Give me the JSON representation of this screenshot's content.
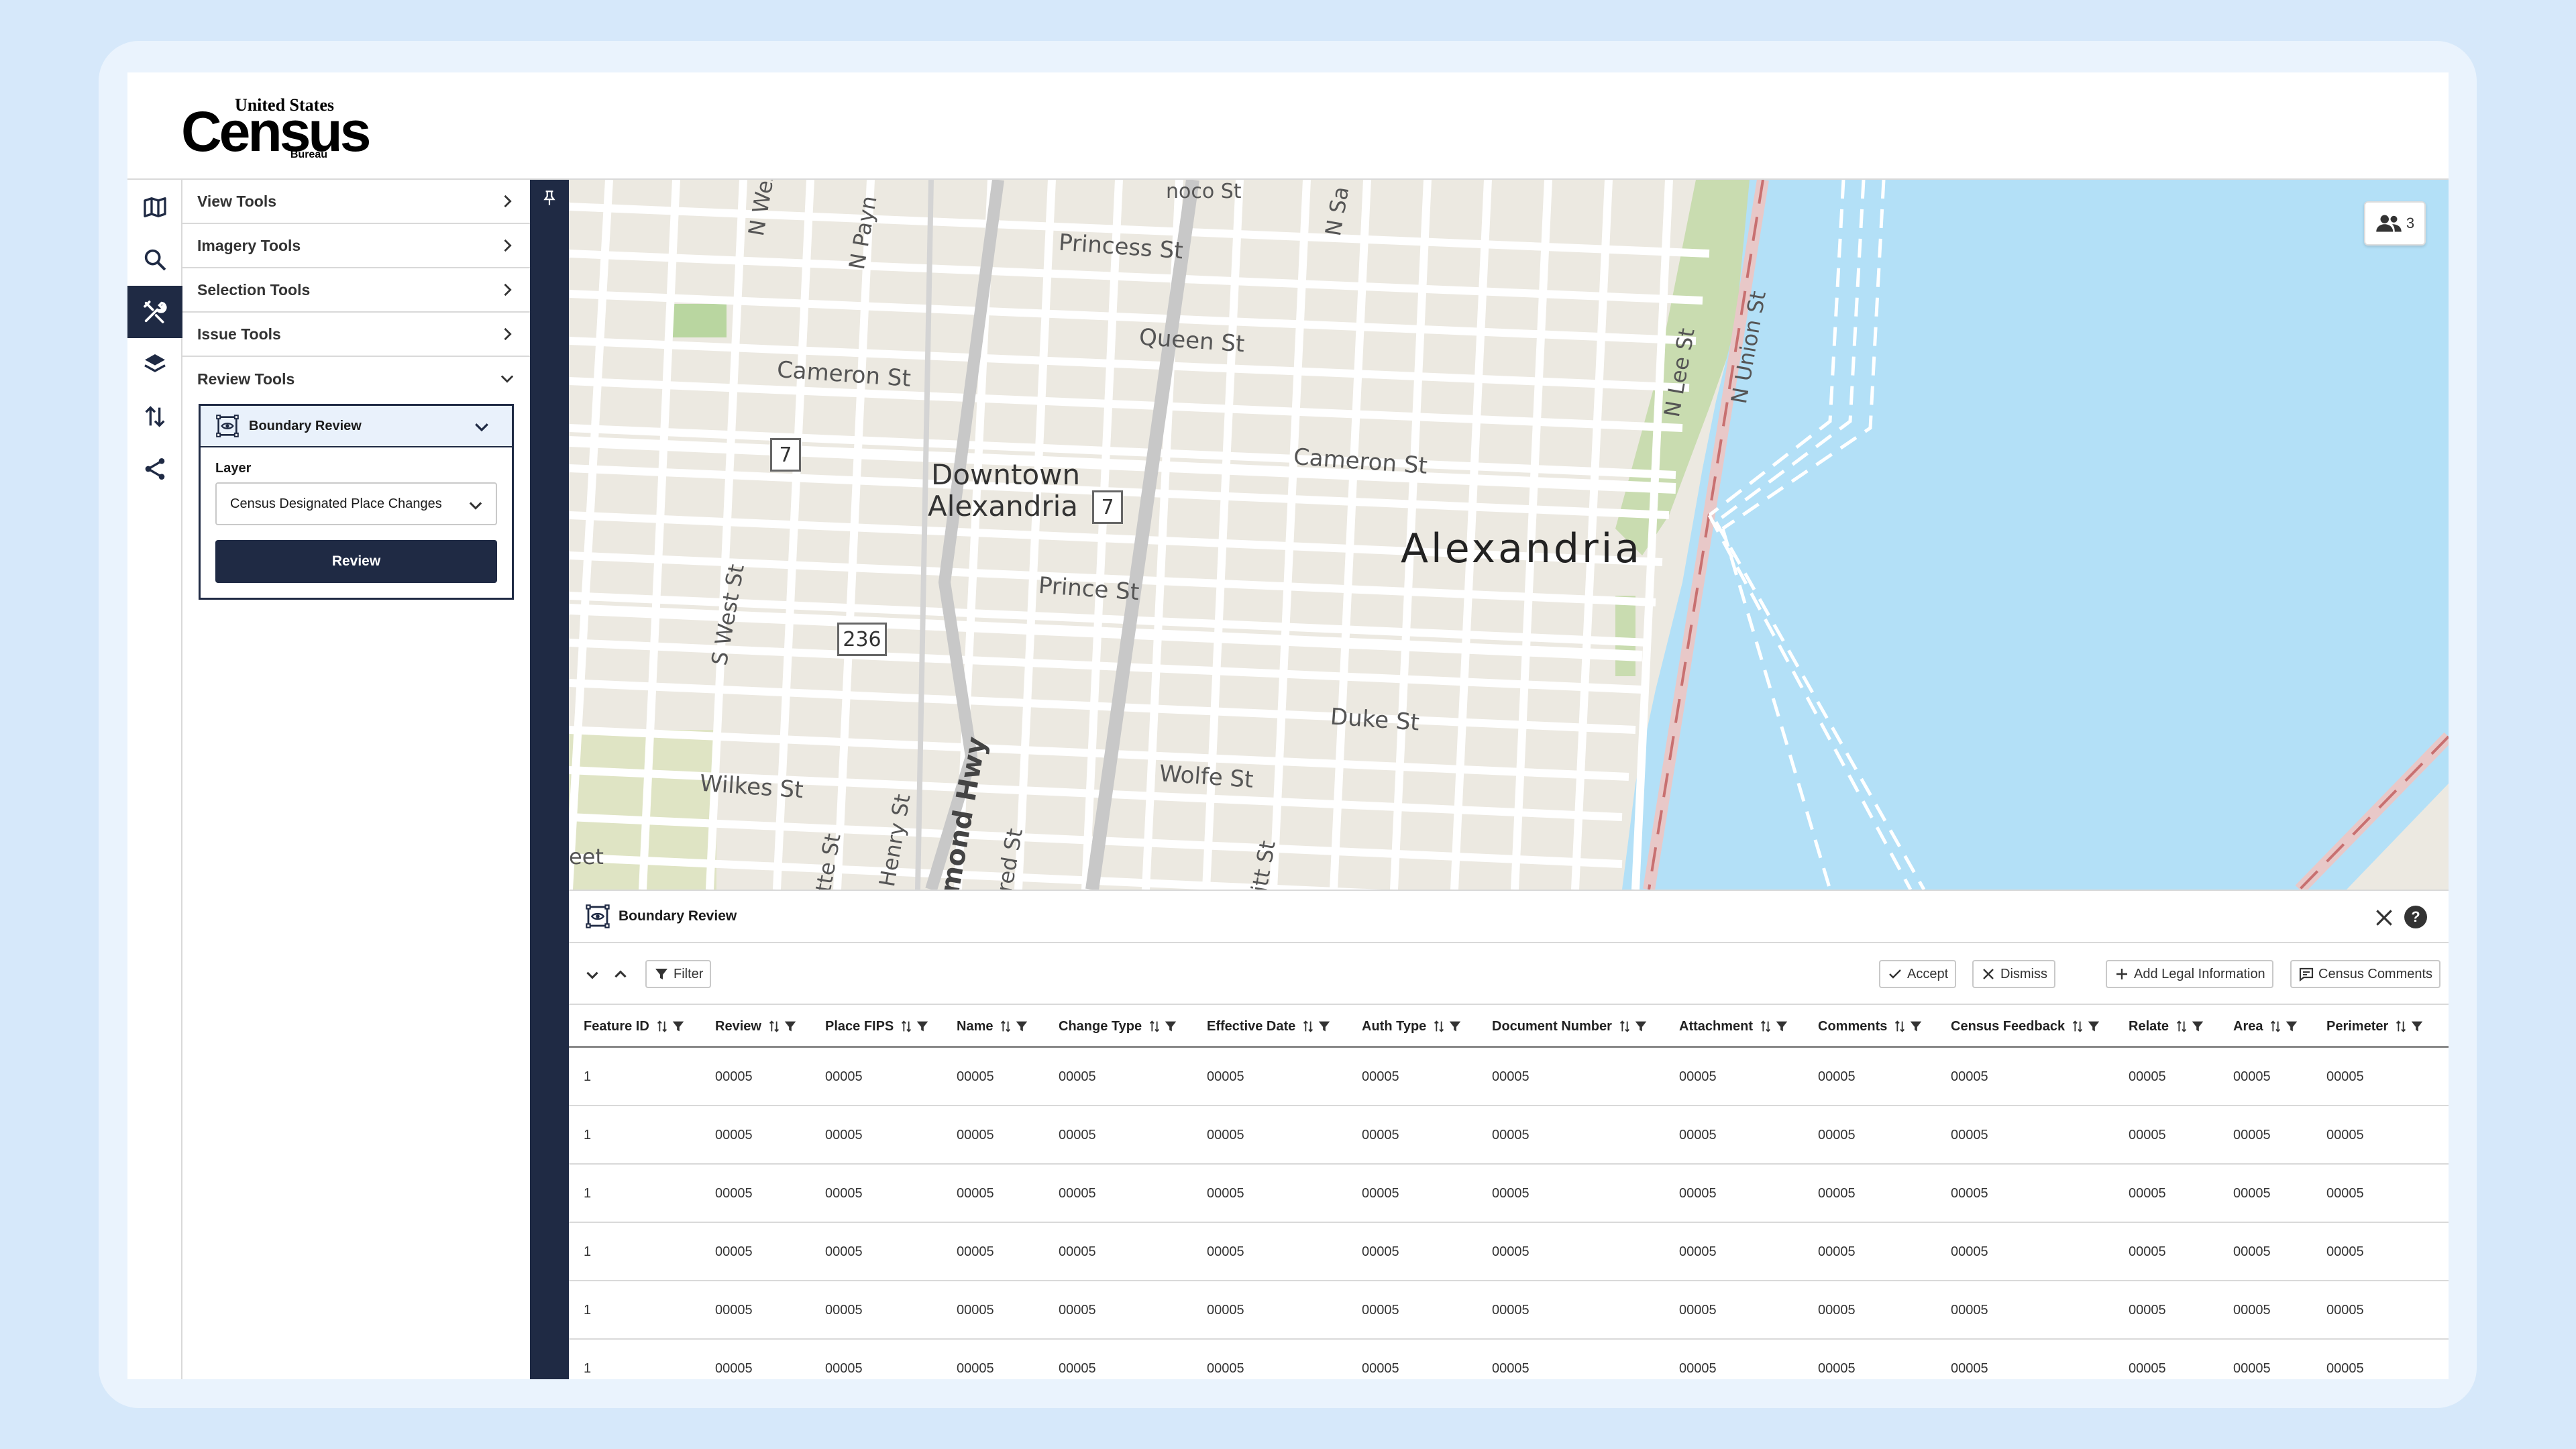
{
  "logo": {
    "top": "United States",
    "main": "Census",
    "bottom": "Bureau"
  },
  "iconbar": [
    "map-icon",
    "search-icon",
    "tools-icon",
    "layers-icon",
    "sort-icon",
    "share-icon"
  ],
  "tools": [
    {
      "label": "View Tools"
    },
    {
      "label": "Imagery Tools"
    },
    {
      "label": "Selection Tools"
    },
    {
      "label": "Issue Tools"
    },
    {
      "label": "Review Tools"
    }
  ],
  "review_panel": {
    "title": "Boundary Review",
    "layer_label": "Layer",
    "layer_value": "Census Designated Place Changes",
    "review_button": "Review"
  },
  "map": {
    "collaborators_count": "3",
    "labels": {
      "city": "Alexandria",
      "downtown_1": "Downtown",
      "downtown_2": "Alexandria",
      "princess": "Princess St",
      "queen": "Queen St",
      "cameron_w": "Cameron St",
      "cameron_e": "Cameron St",
      "prince": "Prince St",
      "duke": "Duke St",
      "wolfe": "Wolfe St",
      "wilkes": "Wilkes St",
      "n_west": "N West St",
      "n_payne": "N Payn",
      "s_west": "S West St",
      "n_lee": "N Lee St",
      "n_union": "N Union St",
      "n_sa": "N Sa",
      "oronoco": "noco St",
      "richmond": "mond Hwy",
      "henry": "Henry St",
      "fred": "red St",
      "tte": "tte St",
      "itt": "itt St",
      "eet": "eet"
    },
    "shields": {
      "r7a": "7",
      "r7b": "7",
      "r236": "236"
    },
    "colors": {
      "land": "#ece9e1",
      "water": "#b3e0f7",
      "park": "#c9dcb0",
      "road": "#ffffff",
      "rail": "#c8c8c8"
    }
  },
  "bottom_panel": {
    "title": "Boundary Review",
    "help": "?",
    "filter": "Filter",
    "actions": [
      "Accept",
      "Dismiss",
      "Add Legal Information",
      "Census Comments"
    ],
    "columns": [
      "Feature ID",
      "Review",
      "Place FIPS",
      "Name",
      "Change Type",
      "Effective Date",
      "Auth Type",
      "Document Number",
      "Attachment",
      "Comments",
      "Census Feedback",
      "Relate",
      "Area",
      "Perimeter"
    ],
    "rows": [
      [
        "1",
        "00005",
        "00005",
        "00005",
        "00005",
        "00005",
        "00005",
        "00005",
        "00005",
        "00005",
        "00005",
        "00005",
        "00005",
        "00005"
      ],
      [
        "1",
        "00005",
        "00005",
        "00005",
        "00005",
        "00005",
        "00005",
        "00005",
        "00005",
        "00005",
        "00005",
        "00005",
        "00005",
        "00005"
      ],
      [
        "1",
        "00005",
        "00005",
        "00005",
        "00005",
        "00005",
        "00005",
        "00005",
        "00005",
        "00005",
        "00005",
        "00005",
        "00005",
        "00005"
      ],
      [
        "1",
        "00005",
        "00005",
        "00005",
        "00005",
        "00005",
        "00005",
        "00005",
        "00005",
        "00005",
        "00005",
        "00005",
        "00005",
        "00005"
      ],
      [
        "1",
        "00005",
        "00005",
        "00005",
        "00005",
        "00005",
        "00005",
        "00005",
        "00005",
        "00005",
        "00005",
        "00005",
        "00005",
        "00005"
      ],
      [
        "1",
        "00005",
        "00005",
        "00005",
        "00005",
        "00005",
        "00005",
        "00005",
        "00005",
        "00005",
        "00005",
        "00005",
        "00005",
        "00005"
      ]
    ]
  }
}
